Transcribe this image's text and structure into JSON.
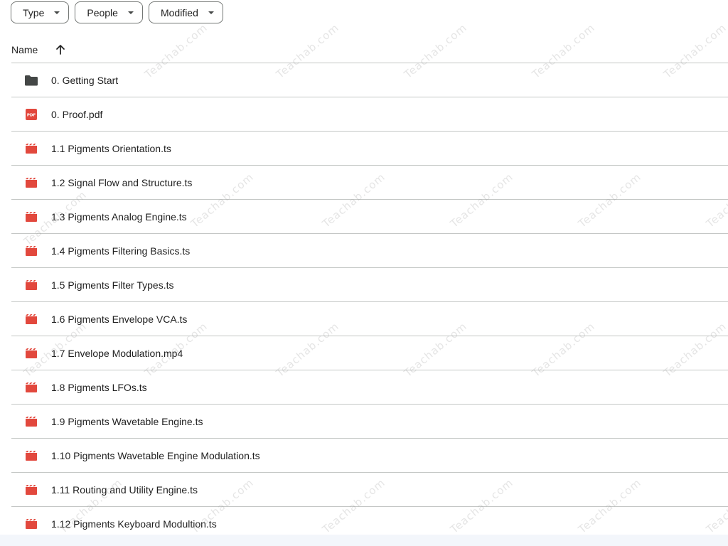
{
  "filters": [
    {
      "label": "Type"
    },
    {
      "label": "People"
    },
    {
      "label": "Modified"
    }
  ],
  "list_header": {
    "name_label": "Name",
    "sort_direction": "ascending"
  },
  "files": [
    {
      "name": "0. Getting Start",
      "icon": "folder-icon"
    },
    {
      "name": "0. Proof.pdf",
      "icon": "pdf-icon"
    },
    {
      "name": "1.1 Pigments Orientation.ts",
      "icon": "video-icon"
    },
    {
      "name": "1.2 Signal Flow and Structure.ts",
      "icon": "video-icon"
    },
    {
      "name": "1.3 Pigments Analog Engine.ts",
      "icon": "video-icon"
    },
    {
      "name": "1.4 Pigments Filtering Basics.ts",
      "icon": "video-icon"
    },
    {
      "name": "1.5 Pigments Filter Types.ts",
      "icon": "video-icon"
    },
    {
      "name": "1.6 Pigments Envelope VCA.ts",
      "icon": "video-icon"
    },
    {
      "name": "1.7 Envelope Modulation.mp4",
      "icon": "video-icon"
    },
    {
      "name": "1.8 Pigments LFOs.ts",
      "icon": "video-icon"
    },
    {
      "name": "1.9 Pigments Wavetable Engine.ts",
      "icon": "video-icon"
    },
    {
      "name": "1.10 Pigments Wavetable Engine Modulation.ts",
      "icon": "video-icon"
    },
    {
      "name": "1.11 Routing and Utility Engine.ts",
      "icon": "video-icon"
    },
    {
      "name": "1.12 Pigments Keyboard Modultion.ts",
      "icon": "video-icon"
    }
  ],
  "watermark_text": "Teachab.com",
  "colors": {
    "folder": "#444746",
    "pdf": "#e2483d",
    "video": "#e2483d",
    "divider": "#c4c7c5"
  }
}
